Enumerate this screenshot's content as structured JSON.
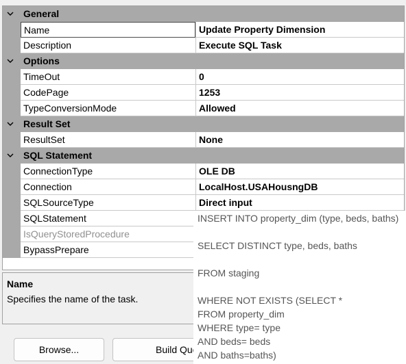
{
  "categories": [
    {
      "label": "General",
      "rows": [
        {
          "name": "Name",
          "value": "Update Property Dimension"
        },
        {
          "name": "Description",
          "value": "Execute SQL Task"
        }
      ]
    },
    {
      "label": "Options",
      "rows": [
        {
          "name": "TimeOut",
          "value": "0"
        },
        {
          "name": "CodePage",
          "value": "1253"
        },
        {
          "name": "TypeConversionMode",
          "value": "Allowed"
        }
      ]
    },
    {
      "label": "Result Set",
      "rows": [
        {
          "name": "ResultSet",
          "value": "None"
        }
      ]
    },
    {
      "label": "SQL Statement",
      "rows": [
        {
          "name": "ConnectionType",
          "value": "OLE DB"
        },
        {
          "name": "Connection",
          "value": "LocalHost.USAHousngDB"
        },
        {
          "name": "SQLSourceType",
          "value": "Direct input"
        },
        {
          "name": "SQLStatement",
          "value": ""
        },
        {
          "name": "IsQueryStoredProcedure",
          "value": ""
        },
        {
          "name": "BypassPrepare",
          "value": ""
        }
      ]
    }
  ],
  "description": {
    "title": "Name",
    "text": "Specifies the name of the task."
  },
  "buttons": {
    "browse": "Browse...",
    "build_query": "Build Query..."
  },
  "sql_popup": {
    "lines": [
      "INSERT INTO property_dim (type, beds, baths)",
      "",
      "SELECT DISTINCT type, beds, baths",
      "",
      "FROM staging",
      "",
      "WHERE NOT EXISTS (SELECT *",
      "FROM  property_dim",
      "WHERE type= type",
      "AND beds= beds",
      "AND baths=baths)"
    ]
  },
  "colors": {
    "category_band": "#a9a9a9",
    "grid_background": "#ffffff",
    "window_background": "#f0f0f0",
    "disabled_text": "#909090",
    "popup_text": "#555555"
  },
  "icons": {
    "category_toggle": "chevron-down-icon"
  }
}
